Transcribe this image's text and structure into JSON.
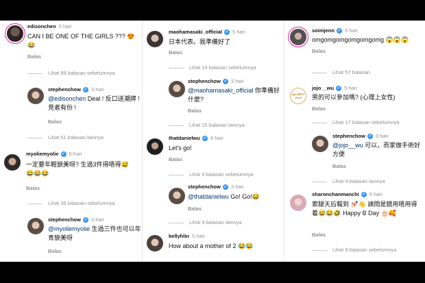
{
  "col1": {
    "c1": {
      "user": "edisonchen",
      "time": "5 hari",
      "text": "CAN I BE ONE OF THE GIRLS ??? 😍😂",
      "reply": "Balas"
    },
    "m1": "Lihat 89 balasan sebelumnya",
    "r1": {
      "user": "stephenchow",
      "time": "3 hari",
      "mention": "@edisonchen",
      "text": " Deal ! 反口送潮牌 ! 見者有份 !",
      "reply": "Balas"
    },
    "m2": "Lihat 51 balasan lainnya",
    "c2": {
      "user": "myoliemyolie",
      "time": "5 hari",
      "text": "一定要年輕貌美呀? 生過3件得唔得😅😂😂😂",
      "reply": "Balas"
    },
    "m3": "Lihat 36 balasan sebelumnya",
    "r2": {
      "user": "stephenchow",
      "time": "3 hari",
      "mention": "@myoliemyolie",
      "text": " 生過三件也可以年青貌美呀",
      "reply": "Balas"
    }
  },
  "col2": {
    "c1": {
      "user": "maohamasaki_official",
      "time": "5 hari",
      "text": "日本代表。我準備好了",
      "reply": "Balas"
    },
    "m1": "Lihat 14 balasan sebelumnya",
    "r1": {
      "user": "stephenchow",
      "time": "3 hari",
      "mention": "@maohamasaki_official",
      "text": " 你準備好什麼?",
      "reply": "Balas"
    },
    "m2": "Lihat 15 balasan lainnya",
    "c2": {
      "user": "thatdanielwu",
      "time": "4 hari",
      "text": "Let's go!",
      "reply": "Balas"
    },
    "m3": "Lihat 9 balasan sebelumnya",
    "r2": {
      "user": "stephenchow",
      "time": "3 hari",
      "mention": "@thatdanielwu",
      "text": " Go! Go!😂",
      "reply": "Balas"
    },
    "m4": "Lihat 4 balasan lainnya",
    "c3": {
      "user": "kellyhlin",
      "time": "5 hari",
      "text": "How about a mother of 2 😂😂"
    }
  },
  "col3": {
    "c1": {
      "user": "soimjenn",
      "time": "5 hari",
      "text": "omgomgomgomgomgomg 😱😱😱",
      "reply": "Balas"
    },
    "m1": "Lihat 57 balasan",
    "c2": {
      "user": "jojo__wu",
      "time": "5 hari",
      "text": "男的可以參加嗎? (心理上女性)",
      "reply": "Balas",
      "avatar_text": "jojo BEST JOJO"
    },
    "m2": "Lihat 17 balasan sebelumnya",
    "r1": {
      "user": "stephenchow",
      "time": "3 hari",
      "mention": "@jojo__wu",
      "text": " 可以，而家做手術好方便",
      "reply": "Balas"
    },
    "m3": "Lihat 4 balasan lainnya",
    "c3": {
      "user": "sharonchanmanchi",
      "time": "5 hari",
      "text": "索腿天后報到 💅🏻👋 請問是錯用唔用得着😅😂🤣 Happy B Day 🎂🥰",
      "reply": "Balas"
    },
    "m4": "Lihat 9 balasan sebelumnya"
  }
}
